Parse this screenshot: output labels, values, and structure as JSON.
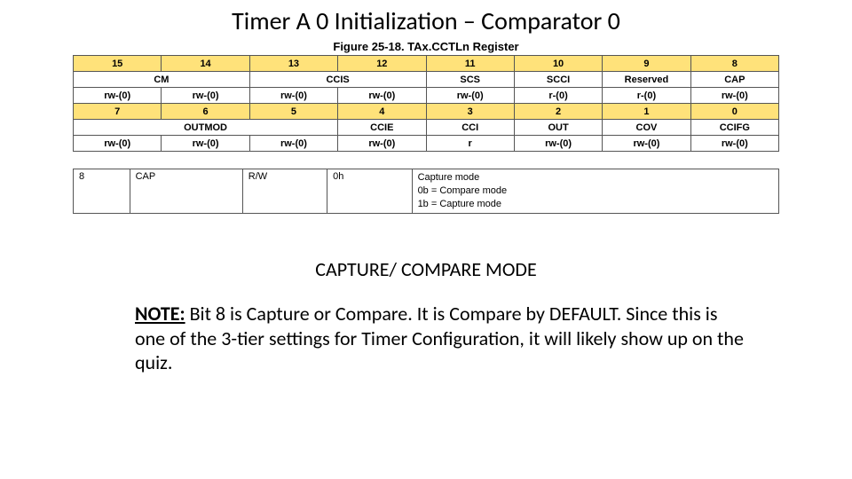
{
  "title": "Timer A 0 Initialization – Comparator 0",
  "figure_caption": "Figure 25-18. TAx.CCTLn Register",
  "reg": {
    "bits_hi": [
      "15",
      "14",
      "13",
      "12",
      "11",
      "10",
      "9",
      "8"
    ],
    "bits_lo": [
      "7",
      "6",
      "5",
      "4",
      "3",
      "2",
      "1",
      "0"
    ],
    "names_hi": [
      {
        "t": "CM",
        "span": 2
      },
      {
        "t": "CCIS",
        "span": 2
      },
      {
        "t": "SCS",
        "span": 1
      },
      {
        "t": "SCCI",
        "span": 1
      },
      {
        "t": "Reserved",
        "span": 1
      },
      {
        "t": "CAP",
        "span": 1
      }
    ],
    "names_lo": [
      {
        "t": "OUTMOD",
        "span": 3
      },
      {
        "t": "CCIE",
        "span": 1
      },
      {
        "t": "CCI",
        "span": 1
      },
      {
        "t": "OUT",
        "span": 1
      },
      {
        "t": "COV",
        "span": 1
      },
      {
        "t": "CCIFG",
        "span": 1
      }
    ],
    "rw_hi": [
      "rw-(0)",
      "rw-(0)",
      "rw-(0)",
      "rw-(0)",
      "rw-(0)",
      "r-(0)",
      "r-(0)",
      "rw-(0)"
    ],
    "rw_lo": [
      "rw-(0)",
      "rw-(0)",
      "rw-(0)",
      "rw-(0)",
      "r",
      "rw-(0)",
      "rw-(0)",
      "rw-(0)"
    ]
  },
  "detail": {
    "bit": "8",
    "field": "CAP",
    "type": "R/W",
    "reset": "0h",
    "desc_lines": [
      "Capture mode",
      "0b = Compare mode",
      "1b = Capture mode"
    ]
  },
  "subtitle": "CAPTURE/ COMPARE MODE",
  "note_lead": "NOTE:",
  "note_body": " Bit 8 is Capture or Compare.  It is Compare by DEFAULT.  Since this is one of the 3-tier settings for Timer Configuration, it will likely show up on the quiz."
}
